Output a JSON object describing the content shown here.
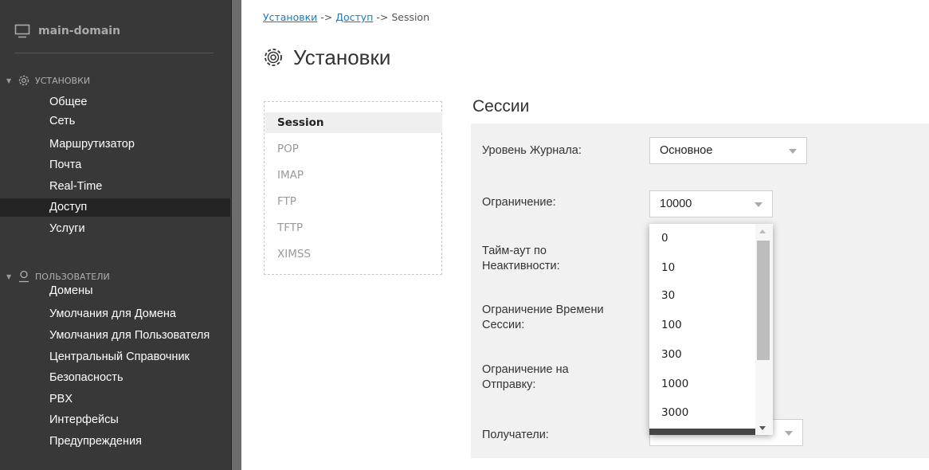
{
  "sidebar": {
    "domain": "main-domain",
    "section_settings": "УСТАНОВКИ",
    "settings_items": [
      "Общее",
      "Сеть",
      "Маршрутизатор",
      "Почта",
      "Real-Time",
      "Доступ",
      "Услуги"
    ],
    "active_item": "Доступ",
    "section_users": "ПОЛЬЗОВАТЕЛИ",
    "users_items": [
      "Домены",
      "Умолчания для Домена",
      "Умолчания для Пользователя",
      "Центральный Справочник",
      "Безопасность",
      "PBX",
      "Интерфейсы",
      "Предупреждения"
    ]
  },
  "breadcrumb": {
    "link1": "Установки",
    "sep1": " -> ",
    "link2": "Доступ",
    "sep2": " -> ",
    "current": "Session"
  },
  "page_title": "Установки",
  "tabs": [
    "Session",
    "POP",
    "IMAP",
    "FTP",
    "TFTP",
    "XIMSS"
  ],
  "active_tab": "Session",
  "section_title": "Сессии",
  "form": {
    "log_level_label": "Уровень Журнала:",
    "log_level_value": "Основное",
    "limit_label": "Ограничение:",
    "limit_value": "10000",
    "idle_timeout_label_1": "Тайм-аут по",
    "idle_timeout_label_2": "Неактивности:",
    "session_time_label_1": "Ограничение Времени",
    "session_time_label_2": "Сессии:",
    "send_limit_label_1": "Ограничение на",
    "send_limit_label_2": "Отправку:",
    "recipients_label": "Получатели:"
  },
  "limit_options": [
    "0",
    "10",
    "30",
    "100",
    "300",
    "1000",
    "3000"
  ]
}
